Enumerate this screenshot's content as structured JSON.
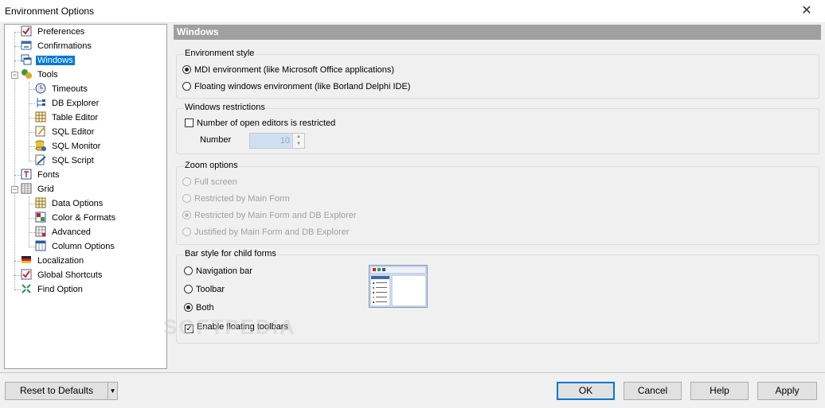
{
  "window": {
    "title": "Environment Options",
    "close_symbol": "✕"
  },
  "tree": {
    "items": [
      {
        "label": "Preferences",
        "icon": "checkbox-form-icon"
      },
      {
        "label": "Confirmations",
        "icon": "dialog-icon"
      },
      {
        "label": "Windows",
        "icon": "windows-icon",
        "selected": true
      },
      {
        "label": "Tools",
        "icon": "tools-icon"
      },
      {
        "label": "Timeouts",
        "icon": "clock-icon"
      },
      {
        "label": "DB Explorer",
        "icon": "tree-icon"
      },
      {
        "label": "Table Editor",
        "icon": "table-icon"
      },
      {
        "label": "SQL Editor",
        "icon": "sql-editor-icon"
      },
      {
        "label": "SQL Monitor",
        "icon": "database-monitor-icon"
      },
      {
        "label": "SQL Script",
        "icon": "script-icon"
      },
      {
        "label": "Fonts",
        "icon": "font-icon"
      },
      {
        "label": "Grid",
        "icon": "grid-icon"
      },
      {
        "label": "Data Options",
        "icon": "grid-data-icon"
      },
      {
        "label": "Color & Formats",
        "icon": "grid-color-icon"
      },
      {
        "label": "Advanced",
        "icon": "grid-advanced-icon"
      },
      {
        "label": "Column Options",
        "icon": "grid-columns-icon"
      },
      {
        "label": "Localization",
        "icon": "flag-icon"
      },
      {
        "label": "Global Shortcuts",
        "icon": "shortcut-icon"
      },
      {
        "label": "Find Option",
        "icon": "arrows-icon"
      }
    ]
  },
  "panel": {
    "header": "Windows",
    "environment_style": {
      "title": "Environment style",
      "options": [
        "MDI environment (like Microsoft Office applications)",
        "Floating windows environment (like Borland Delphi IDE)"
      ],
      "selected": 0
    },
    "restrictions": {
      "title": "Windows restrictions",
      "checkbox_label": "Number of open editors is restricted",
      "checked": false,
      "number_label": "Number",
      "number_value": "10"
    },
    "zoom": {
      "title": "Zoom options",
      "options": [
        "Full screen",
        "Restricted by Main Form",
        "Restricted by Main Form and DB Explorer",
        "Justified by Main Form and DB Explorer"
      ],
      "selected": 2,
      "disabled": true
    },
    "bar_style": {
      "title": "Bar style for child forms",
      "options": [
        "Navigation bar",
        "Toolbar",
        "Both"
      ],
      "selected": 2,
      "floating_label": "Enable floating toolbars",
      "floating_checked": true
    }
  },
  "footer": {
    "reset_label": "Reset to Defaults",
    "ok_label": "OK",
    "cancel_label": "Cancel",
    "help_label": "Help",
    "apply_label": "Apply"
  },
  "watermark": "SOFTPEDIA"
}
